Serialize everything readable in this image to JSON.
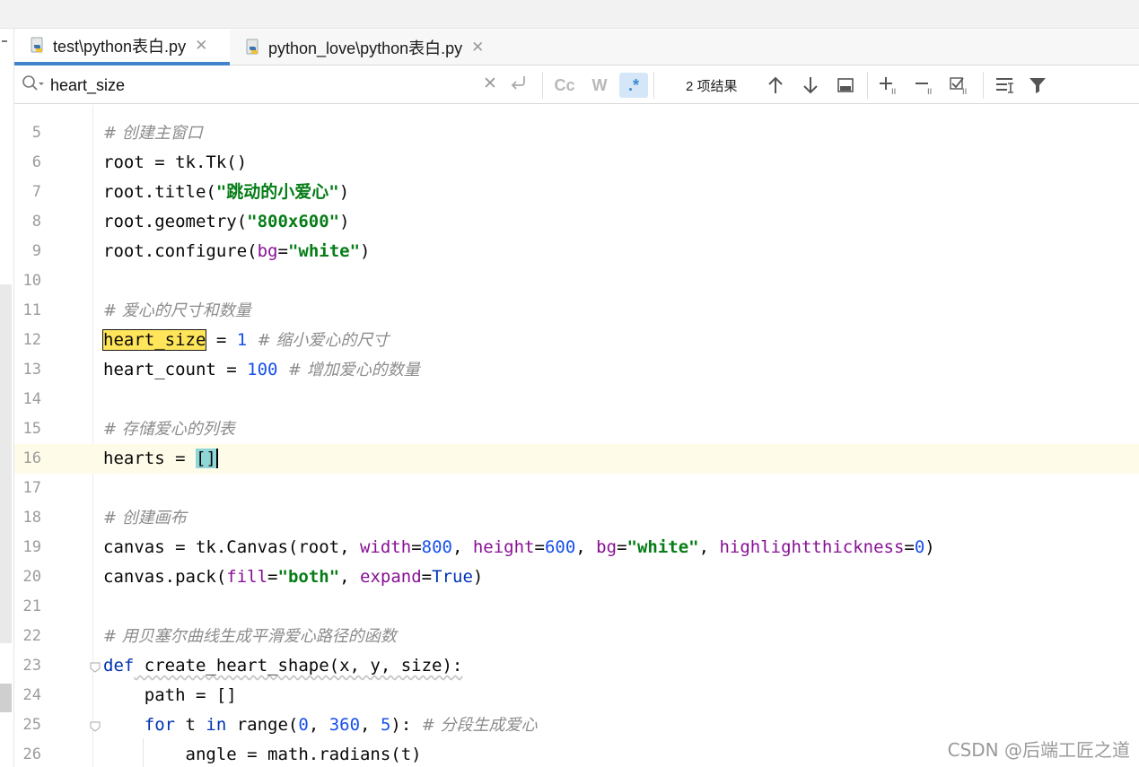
{
  "tabs": [
    {
      "label": "test\\python表白.py",
      "active": true
    },
    {
      "label": "python_love\\python表白.py",
      "active": false
    }
  ],
  "find": {
    "query": "heart_size",
    "results": "2 项结果",
    "case_label": "Cc",
    "word_label": "W",
    "regex_label": ".*"
  },
  "editor": {
    "first_partial_line": "4",
    "lines": [
      {
        "n": "5"
      },
      {
        "n": "6"
      },
      {
        "n": "7"
      },
      {
        "n": "8"
      },
      {
        "n": "9"
      },
      {
        "n": "10"
      },
      {
        "n": "11"
      },
      {
        "n": "12"
      },
      {
        "n": "13"
      },
      {
        "n": "14"
      },
      {
        "n": "15"
      },
      {
        "n": "16"
      },
      {
        "n": "17"
      },
      {
        "n": "18"
      },
      {
        "n": "19"
      },
      {
        "n": "20"
      },
      {
        "n": "21"
      },
      {
        "n": "22"
      },
      {
        "n": "23"
      },
      {
        "n": "24"
      },
      {
        "n": "25"
      },
      {
        "n": "26"
      }
    ],
    "text": {
      "c5": "# 创建主窗口",
      "l6": "root = tk.Tk()",
      "l7a": "root.title(",
      "l7s": "\"跳动的小爱心\"",
      "l7b": ")",
      "l8a": "root.geometry(",
      "l8s": "\"800x600\"",
      "l8b": ")",
      "l9a": "root.configure(",
      "l9k": "bg",
      "l9e": "=",
      "l9s": "\"white\"",
      "l9b": ")",
      "c11": "# 爱心的尺寸和数量",
      "l12v": "heart_size",
      "l12e": " = ",
      "l12n": "1",
      "l12c": "  # 缩小爱心的尺寸",
      "l13v": "heart_count = ",
      "l13n": "100",
      "l13c": "  # 增加爱心的数量",
      "c15": "# 存储爱心的列表",
      "l16v": "hearts = ",
      "l16o": "[",
      "l16cl": "]",
      "c18": "# 创建画布",
      "l19a": "canvas = tk.Canvas(root, ",
      "l19k1": "width",
      "l19e1": "=",
      "l19n1": "800",
      "l19c1": ", ",
      "l19k2": "height",
      "l19e2": "=",
      "l19n2": "600",
      "l19c2": ", ",
      "l19k3": "bg",
      "l19e3": "=",
      "l19s3": "\"white\"",
      "l19c3": ", ",
      "l19k4": "highlightthickness",
      "l19e4": "=",
      "l19n4": "0",
      "l19b": ")",
      "l20a": "canvas.pack(",
      "l20k1": "fill",
      "l20e1": "=",
      "l20s1": "\"both\"",
      "l20c1": ", ",
      "l20k2": "expand",
      "l20e2": "=",
      "l20v2": "True",
      "l20b": ")",
      "c22": "# 用贝塞尔曲线生成平滑爱心路径的函数",
      "l23k": "def",
      "l23r": " create_heart_shape(x, y, size):",
      "l24": "    path = []",
      "l25k1": "    for",
      "l25a": " t ",
      "l25k2": "in",
      "l25b": " range(",
      "l25n1": "0",
      "l25c1": ", ",
      "l25n2": "360",
      "l25c2": ", ",
      "l25n3": "5",
      "l25d": "):",
      "l25cm": "  # 分段生成爱心",
      "l26": "        angle = math.radians(t)"
    }
  },
  "watermark": "CSDN @后端工匠之道",
  "colors": {
    "accent_tab": "#4083c9",
    "search_highlight": "#ffe55a",
    "current_line": "#fefbe9",
    "string": "#067d17",
    "number": "#1750eb",
    "keyword": "#0033b3",
    "kwarg": "#871094",
    "comment": "#8c8c8c"
  }
}
